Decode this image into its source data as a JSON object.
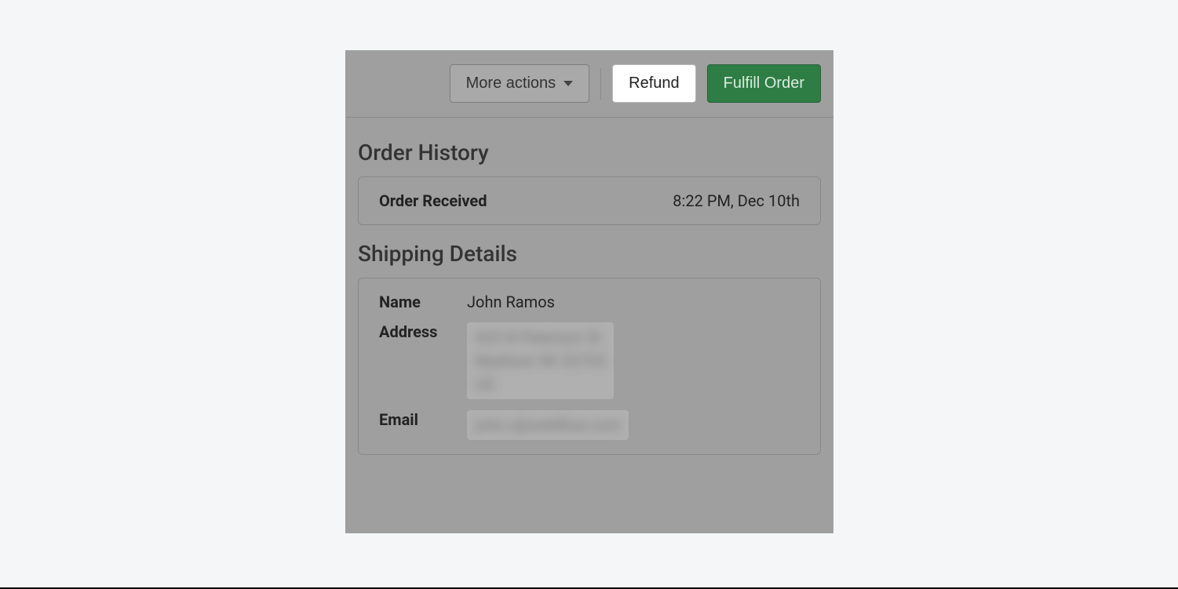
{
  "toolbar": {
    "more_actions_label": "More actions",
    "refund_label": "Refund",
    "fulfill_label": "Fulfill Order"
  },
  "history": {
    "heading": "Order History",
    "items": [
      {
        "label": "Order Received",
        "timestamp": "8:22 PM, Dec 10th"
      }
    ]
  },
  "shipping": {
    "heading": "Shipping Details",
    "name_label": "Name",
    "name_value": "John Ramos",
    "address_label": "Address",
    "address_value_line1": "433 N Paterson St",
    "address_value_line2": "Madison WI 53703",
    "address_value_line3": "US",
    "email_label": "Email",
    "email_value": "john.r@webflow.com"
  }
}
